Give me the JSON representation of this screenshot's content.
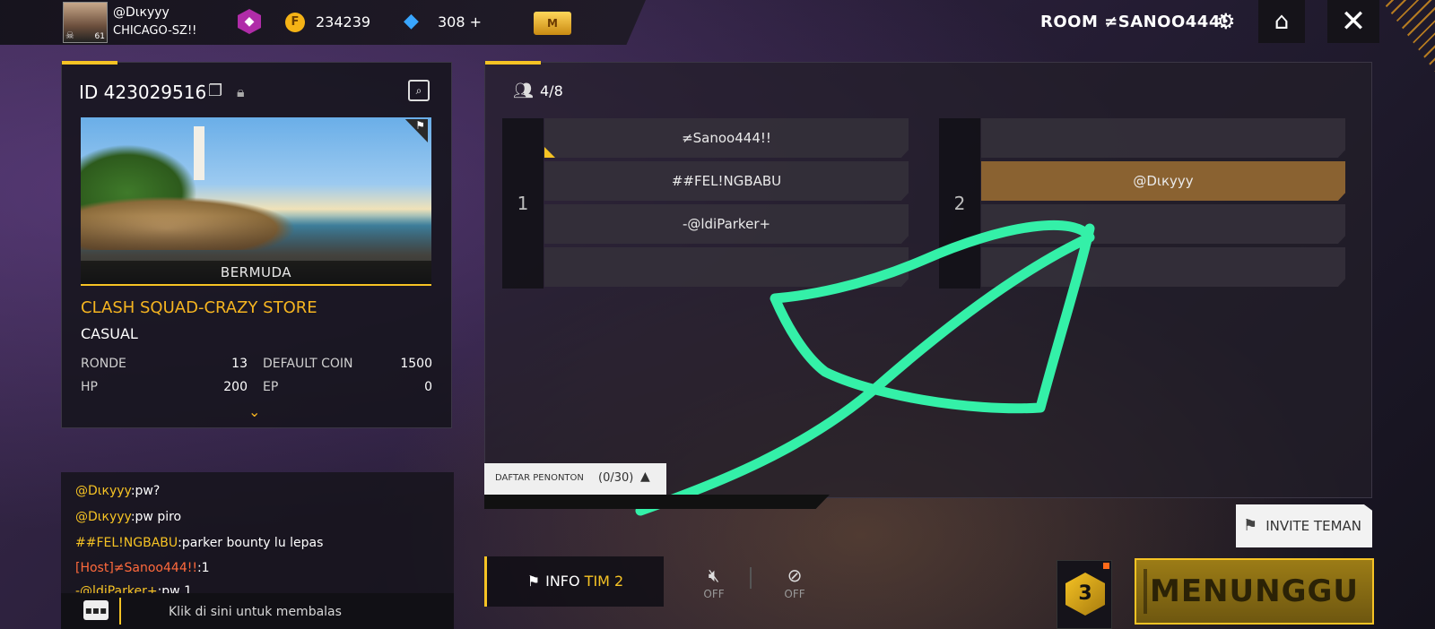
{
  "top_bar": {
    "player_name": "@Dιкyyy",
    "player_guild": "CHICAGO-SZ!!",
    "player_level": "61",
    "badge_icon": "rank-badge-icon",
    "coin_icon": "F",
    "coins": "234239",
    "diamonds": "308",
    "diamonds_add": "+",
    "membership_icon": "M"
  },
  "header": {
    "room_title": "ROOM ≠SANOO444!",
    "settings_icon": "gear-icon",
    "home_icon": "home-icon",
    "close_icon": "close-icon"
  },
  "room_info": {
    "id_label": "ID",
    "id_value": "423029516",
    "map_name": "BERMUDA",
    "mode_title": "CLASH SQUAD-CRAZY STORE",
    "mode_sub": "CASUAL",
    "stats": [
      {
        "label": "RONDE",
        "value": "13"
      },
      {
        "label": "DEFAULT COIN",
        "value": "1500"
      },
      {
        "label": "HP",
        "value": "200"
      },
      {
        "label": "EP",
        "value": "0"
      }
    ]
  },
  "teams": {
    "players_count": "4/8",
    "team1": {
      "number": "1",
      "slots": [
        "≠Sanoo444!!",
        "##FEL!NGBABU",
        "-@ldiParker+",
        ""
      ]
    },
    "team2": {
      "number": "2",
      "slots": [
        "",
        "@Dιкyyy",
        "",
        ""
      ],
      "active_slot": 1
    }
  },
  "spectators": {
    "label": "DAFTAR PENONTON",
    "count": "(0/30)",
    "arrow": "▲"
  },
  "chat": {
    "messages": [
      {
        "who": "@Dιкyyy",
        "text": ":pw?"
      },
      {
        "who": "@Dιкyyy",
        "text": ":pw piro"
      },
      {
        "who": "##FEL!NGBABU",
        "text": ":parker bounty lu lepas"
      },
      {
        "who": "[Host]≠Sanoo444!!",
        "text": ":1",
        "host": true
      },
      {
        "who": "-@ldiParker+",
        "text": ":pw 1"
      }
    ],
    "reply_placeholder": "Klik di sini untuk membalas"
  },
  "controls": {
    "info_label": "INFO",
    "info_team": "TIM 2",
    "speaker_state": "OFF",
    "mic_state": "OFF",
    "invite_label": "INVITE TEMAN",
    "dice_value": "3",
    "wait_label": "MENUNGGU"
  },
  "colors": {
    "accent": "#f6c324",
    "active_slot": "#8a6231",
    "annotation": "#34f0a8"
  }
}
